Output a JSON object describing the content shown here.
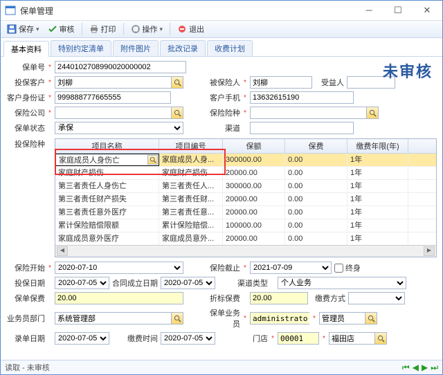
{
  "window": {
    "title": "保单管理"
  },
  "toolbar": {
    "save": "保存",
    "audit": "审核",
    "print": "打印",
    "action": "操作",
    "exit": "退出"
  },
  "tabs": [
    "基本资料",
    "特别约定清单",
    "附件图片",
    "批改记录",
    "收费计划"
  ],
  "watermark": "未审核",
  "fields": {
    "policy_no_lbl": "保单号",
    "policy_no": "2440102708990020000002",
    "applicant_lbl": "投保客户",
    "applicant": "刘柳",
    "insured_lbl": "被保险人",
    "insured": "刘柳",
    "beneficiary_lbl": "受益人",
    "beneficiary": "",
    "cust_id_lbl": "客户身份证",
    "cust_id": "999888777665555",
    "cust_phone_lbl": "客户手机",
    "cust_phone": "13632615190",
    "company_lbl": "保险公司",
    "company": "",
    "ins_kind_lbl": "保险险种",
    "ins_kind": "",
    "status_lbl": "保单状态",
    "status": "承保",
    "channel_lbl": "渠道",
    "channel": "",
    "coverage_lbl": "投保险种",
    "start_lbl": "保险开始",
    "start": "2020-07-10",
    "end_lbl": "保险截止",
    "end": "2021-07-09",
    "lifetime_lbl": "终身",
    "apply_date_lbl": "投保日期",
    "apply_date": "2020-07-05",
    "contract_date_lbl": "合同成立日期",
    "contract_date": "2020-07-05",
    "ch_type_lbl": "渠道类型",
    "ch_type": "个人业务",
    "premium_lbl": "保单保费",
    "premium": "20.00",
    "disc_premium_lbl": "折标保费",
    "disc_premium": "20.00",
    "pay_mode_lbl": "缴费方式",
    "pay_mode": "",
    "dept_lbl": "业务员部门",
    "dept": "系统管理部",
    "agent_lbl": "保单业务员",
    "agent_code": "administrator",
    "agent_name": "管理员",
    "entry_date_lbl": "录单日期",
    "entry_date": "2020-07-05",
    "pay_time_lbl": "缴费时间",
    "pay_time": "2020-07-05",
    "store_lbl": "门店",
    "store_code": "00001",
    "store_name": "福田店"
  },
  "grid": {
    "cols": [
      "项目名称",
      "项目编号",
      "保额",
      "保费",
      "缴费年限(年)"
    ],
    "rows": [
      {
        "name": "家庭成员人身伤亡",
        "code": "家庭成员人身...",
        "amount": "300000.00",
        "fee": "0.00",
        "years": "1年"
      },
      {
        "name": "家庭财产损伤",
        "code": "家庭财产损伤",
        "amount": "20000.00",
        "fee": "0.00",
        "years": "1年"
      },
      {
        "name": "第三者责任人身伤亡",
        "code": "第三者责任人...",
        "amount": "300000.00",
        "fee": "0.00",
        "years": "1年"
      },
      {
        "name": "第三者责任财产损失",
        "code": "第三者责任财...",
        "amount": "20000.00",
        "fee": "0.00",
        "years": "1年"
      },
      {
        "name": "第三者责任意外医疗",
        "code": "第三者责任意...",
        "amount": "20000.00",
        "fee": "0.00",
        "years": "1年"
      },
      {
        "name": "累计保险赔偿限额",
        "code": "累计保险赔偿...",
        "amount": "100000.00",
        "fee": "0.00",
        "years": "1年"
      },
      {
        "name": "家庭成员意外医疗",
        "code": "家庭成员意外...",
        "amount": "20000.00",
        "fee": "0.00",
        "years": "1年"
      }
    ]
  },
  "status": "读取 - 未审核"
}
